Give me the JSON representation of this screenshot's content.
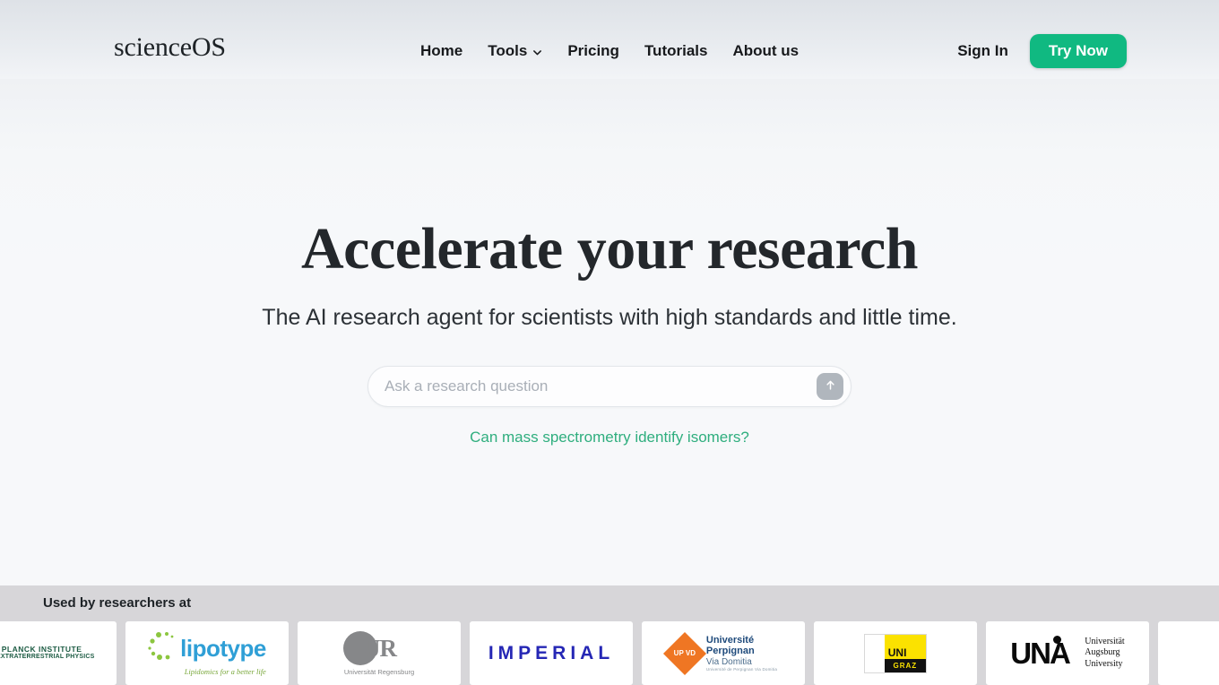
{
  "header": {
    "logo": "scienceOS",
    "nav": [
      {
        "label": "Home",
        "has_chevron": false
      },
      {
        "label": "Tools",
        "has_chevron": true
      },
      {
        "label": "Pricing",
        "has_chevron": false
      },
      {
        "label": "Tutorials",
        "has_chevron": false
      },
      {
        "label": "About us",
        "has_chevron": false
      }
    ],
    "sign_in": "Sign In",
    "try_now": "Try Now",
    "accent_color": "#10b981"
  },
  "hero": {
    "title": "Accelerate your research",
    "subtitle": "The AI research agent for scientists with high standards and little time.",
    "search_placeholder": "Ask a research question",
    "search_value": "",
    "submit_icon": "arrow-up-icon",
    "suggestion": "Can mass spectrometry identify isomers?",
    "suggestion_color": "#2fae7e"
  },
  "logos_section": {
    "label": "Used by researchers at",
    "logos": [
      {
        "name": "Max Planck Institute for Extraterrestrial Physics",
        "line1": "MAX PLANCK INSTITUTE",
        "line2": "FOR EXTRATERRESTRIAL PHYSICS",
        "color": "#1c5b43"
      },
      {
        "name": "Lipotype",
        "wordmark": "lipotype",
        "tagline": "Lipidomics for a better life",
        "color": "#2f9fd6"
      },
      {
        "name": "Universität Regensburg",
        "wordmark": "UR",
        "subtitle": "Universität Regensburg",
        "color": "#868789"
      },
      {
        "name": "Imperial College London",
        "wordmark": "IMPERIAL",
        "color": "#2527b5"
      },
      {
        "name": "Université Perpignan Via Domitia",
        "badge": "UP VD",
        "line1": "Université",
        "line2": "Perpignan",
        "line3": "Via Domitia",
        "line4": "Université de Perpignan Via Domitia",
        "color": "#ef7623"
      },
      {
        "name": "Universität Graz",
        "wordmark": "UNI",
        "subtitle": "GRAZ",
        "color": "#fbe200"
      },
      {
        "name": "Universität Augsburg",
        "wordmark": "UNA",
        "line1": "Universität",
        "line2": "Augsburg",
        "line3": "University",
        "color": "#0a0a0a"
      }
    ]
  }
}
